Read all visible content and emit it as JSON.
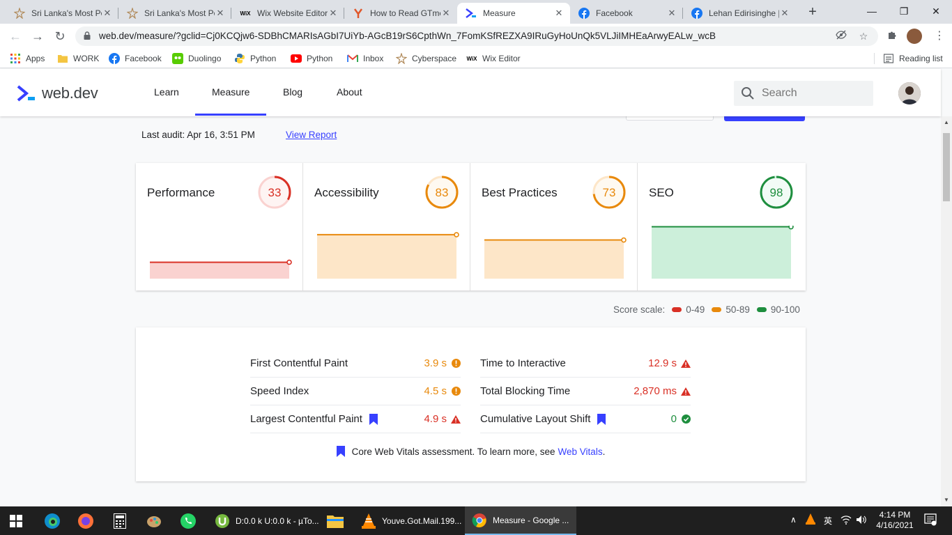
{
  "browser": {
    "tabs": [
      {
        "title": "Sri Lanka's Most Po",
        "favicon": "star-icon"
      },
      {
        "title": "Sri Lanka's Most Po",
        "favicon": "star-icon"
      },
      {
        "title": "Wix Website Editor",
        "favicon": "wix-icon",
        "favicon_text": "WiX"
      },
      {
        "title": "How to Read GTmetrix",
        "favicon": "gtmetrix-icon"
      },
      {
        "title": "Measure",
        "favicon": "webdev-icon",
        "active": true
      },
      {
        "title": "Facebook",
        "favicon": "facebook-icon"
      },
      {
        "title": "Lehan Edirisinghe | F",
        "favicon": "facebook-icon"
      }
    ],
    "url": "web.dev/measure/?gclid=Cj0KCQjw6-SDBhCMARIsAGbI7UiYb-AGcB19rS6CpthWn_7FomKSfREZXA9IRuGyHoUnQk5VLJiIMHEaArwyEALw_wcB",
    "bookmarks": [
      {
        "label": "Apps",
        "icon": "apps-grid-icon"
      },
      {
        "label": "WORK",
        "icon": "folder-icon"
      },
      {
        "label": "Facebook",
        "icon": "facebook-icon"
      },
      {
        "label": "Duolingo",
        "icon": "duolingo-icon"
      },
      {
        "label": "Python",
        "icon": "python-icon"
      },
      {
        "label": "Python",
        "icon": "youtube-icon"
      },
      {
        "label": "Inbox",
        "icon": "gmail-icon"
      },
      {
        "label": "Cyberspace",
        "icon": "star-icon"
      },
      {
        "label": "Wix Editor",
        "icon": "wix-icon",
        "icon_text": "WiX"
      }
    ],
    "reading_list": "Reading list"
  },
  "site": {
    "logo_text": "web.dev",
    "nav": [
      "Learn",
      "Measure",
      "Blog",
      "About"
    ],
    "active_nav": "Measure",
    "search_placeholder": "Search"
  },
  "audit": {
    "last_audit": "Last audit: Apr 16, 3:51 PM",
    "view_report": "View Report"
  },
  "scores": [
    {
      "label": "Performance",
      "value": 33,
      "color": "#d93025",
      "fill": "#fad2d0",
      "history": [
        0.31,
        0.31
      ]
    },
    {
      "label": "Accessibility",
      "value": 83,
      "color": "#e8890c",
      "fill": "#fde6c8",
      "history": [
        0.83,
        0.83
      ]
    },
    {
      "label": "Best Practices",
      "value": 73,
      "color": "#e8890c",
      "fill": "#fde6c8",
      "history": [
        0.73,
        0.73
      ]
    },
    {
      "label": "SEO",
      "value": 98,
      "color": "#1e8e3e",
      "fill": "#ccefda",
      "history": [
        0.98,
        0.98
      ]
    }
  ],
  "score_scale": {
    "label": "Score scale:",
    "ranges": [
      {
        "label": "0-49",
        "color": "#d93025"
      },
      {
        "label": "50-89",
        "color": "#e8890c"
      },
      {
        "label": "90-100",
        "color": "#1e8e3e"
      }
    ]
  },
  "metrics": [
    {
      "name": "First Contentful Paint",
      "value": "3.9 s",
      "status": "average",
      "core": false
    },
    {
      "name": "Time to Interactive",
      "value": "12.9 s",
      "status": "fail",
      "core": false
    },
    {
      "name": "Speed Index",
      "value": "4.5 s",
      "status": "average",
      "core": false
    },
    {
      "name": "Total Blocking Time",
      "value": "2,870 ms",
      "status": "fail",
      "core": false
    },
    {
      "name": "Largest Contentful Paint",
      "value": "4.9 s",
      "status": "fail",
      "core": true
    },
    {
      "name": "Cumulative Layout Shift",
      "value": "0",
      "status": "pass",
      "core": true
    }
  ],
  "cwv_note": {
    "text": "Core Web Vitals assessment. To learn more, see",
    "link": "Web Vitals",
    "suffix": "."
  },
  "taskbar": {
    "apps": [
      {
        "label": "D:0.0 k U:0.0 k - µTo...",
        "icon": "utorrent-icon"
      },
      {
        "label": "Youve.Got.Mail.199...",
        "icon": "vlc-icon"
      },
      {
        "label": "Measure - Google ...",
        "icon": "chrome-icon",
        "active": true
      }
    ],
    "time": "4:14 PM",
    "date": "4/16/2021"
  }
}
